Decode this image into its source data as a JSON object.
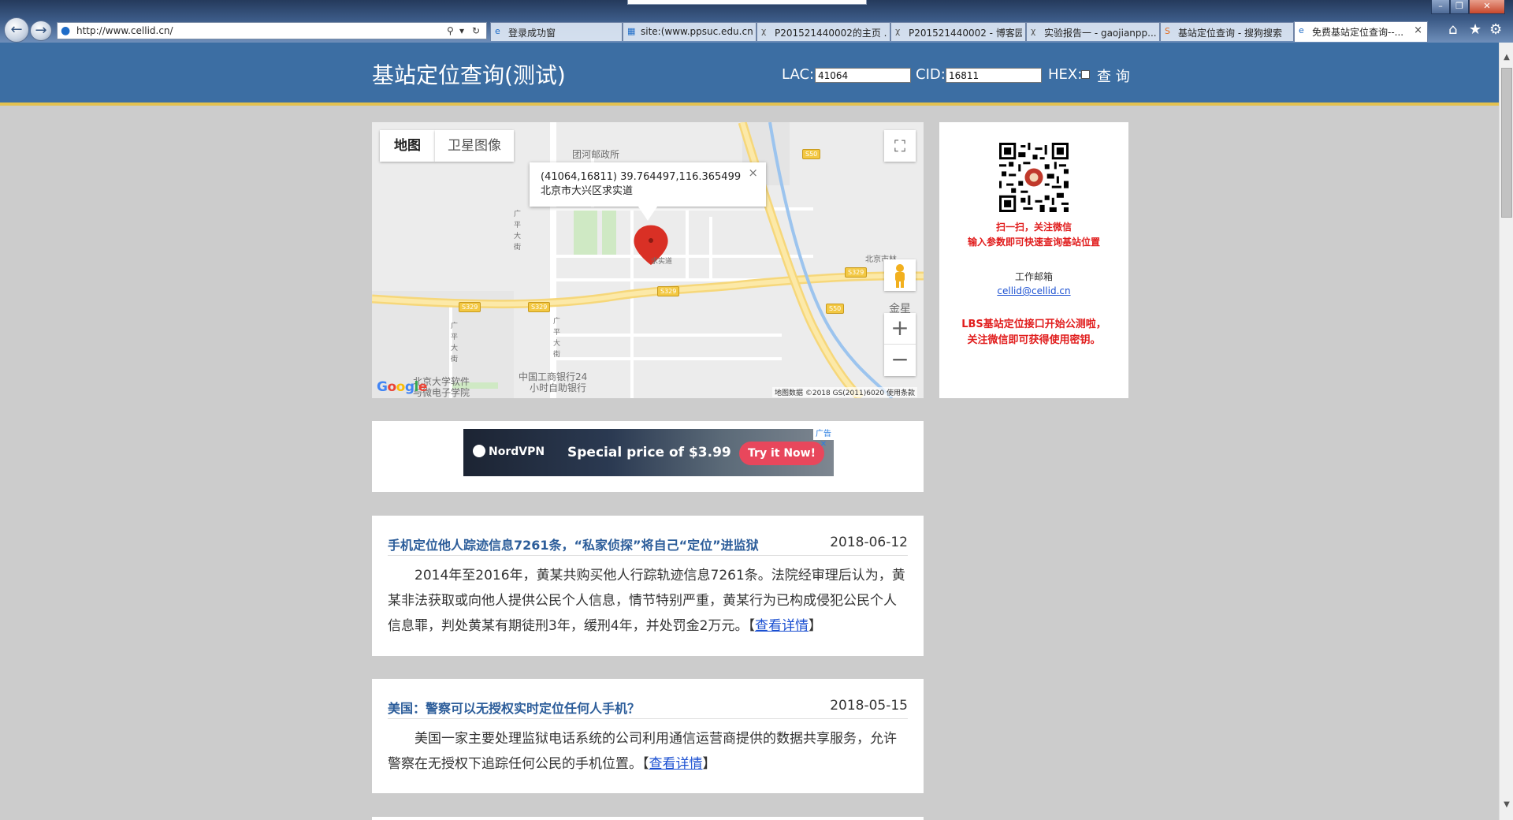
{
  "browser": {
    "url": "http://www.cellid.cn/",
    "tabs": [
      {
        "label": "登录成功窗",
        "icon": "ie-page-icon"
      },
      {
        "label": "site:(www.ppsuc.edu.cn...",
        "icon": "search-page-icon"
      },
      {
        "label": "P201521440002的主页 ...",
        "icon": "blog-page-icon"
      },
      {
        "label": "P201521440002 - 博客园",
        "icon": "blog-page-icon"
      },
      {
        "label": "实验报告一 - gaojianpp...",
        "icon": "blog-page-icon"
      },
      {
        "label": "基站定位查询 - 搜狗搜索",
        "icon": "sogou-page-icon"
      },
      {
        "label": "免费基站定位查询--...",
        "icon": "ie-page-icon",
        "active": true
      }
    ]
  },
  "header": {
    "title": "基站定位查询(测试)",
    "lac_label": "LAC:",
    "lac_value": "41064",
    "cid_label": "CID:",
    "cid_value": "16811",
    "hex_label": "HEX:",
    "query_label": "查 询"
  },
  "map": {
    "type_map": "地图",
    "type_satellite": "卫星图像",
    "info_line1": "(41064,16811) 39.764497,116.365499",
    "info_line2": "北京市大兴区求实道",
    "zoom_in": "+",
    "zoom_out": "−",
    "attribution": "地图数据 ©2018 GS(2011)6020   使用条款",
    "google": "Google",
    "labels": {
      "post_office": "团河邮政所",
      "guangping": "广平大街",
      "guangping2": "广平大街",
      "guangping3": "广平大街",
      "qiushi": "求实道",
      "jinxing": "金星",
      "pku": "北京大学软件",
      "pku2": "与微电子学院",
      "icbc": "中国工商银行24",
      "icbc2": "小时自助银行",
      "beijing_factory": "北京市林",
      "s50": "S50",
      "s329": "S329"
    }
  },
  "side": {
    "line1": "扫一扫，关注微信",
    "line2": "输入参数即可快速查询基站位置",
    "email_label": "工作邮箱",
    "email": "cellid@cellid.cn",
    "lbs_line1": "LBS基站定位接口开始公测啦，",
    "lbs_line2": "关注微信即可获得使用密钥。"
  },
  "ad": {
    "brand": "NordVPN",
    "text": "Special price of $3.99",
    "cta": "Try it Now!",
    "badge": "广告 ✕"
  },
  "articles": [
    {
      "title": "手机定位他人踪迹信息7261条，“私家侦探”将自己“定位”进监狱",
      "date": "2018-06-12",
      "body": "2014年至2016年，黄某共购买他人行踪轨迹信息7261条。法院经审理后认为，黄某非法获取或向他人提供公民个人信息，情节特别严重，黄某行为已构成侵犯公民个人信息罪，判处黄某有期徒刑3年，缓刑4年，并处罚金2万元。",
      "link": "查看详情"
    },
    {
      "title": "美国：警察可以无授权实时定位任何人手机？",
      "date": "2018-05-15",
      "body": "美国一家主要处理监狱电话系统的公司利用通信运营商提供的数据共享服务，允许警察在无授权下追踪任何公民的手机位置。",
      "link": "查看详情"
    }
  ],
  "colors": {
    "header_bg": "#3c6ea3",
    "header_accent": "#e3c14f",
    "link": "#1a4fd1",
    "title_blue": "#2c5d9a",
    "promo_red": "#e11d1d",
    "marker_red": "#d93025"
  }
}
